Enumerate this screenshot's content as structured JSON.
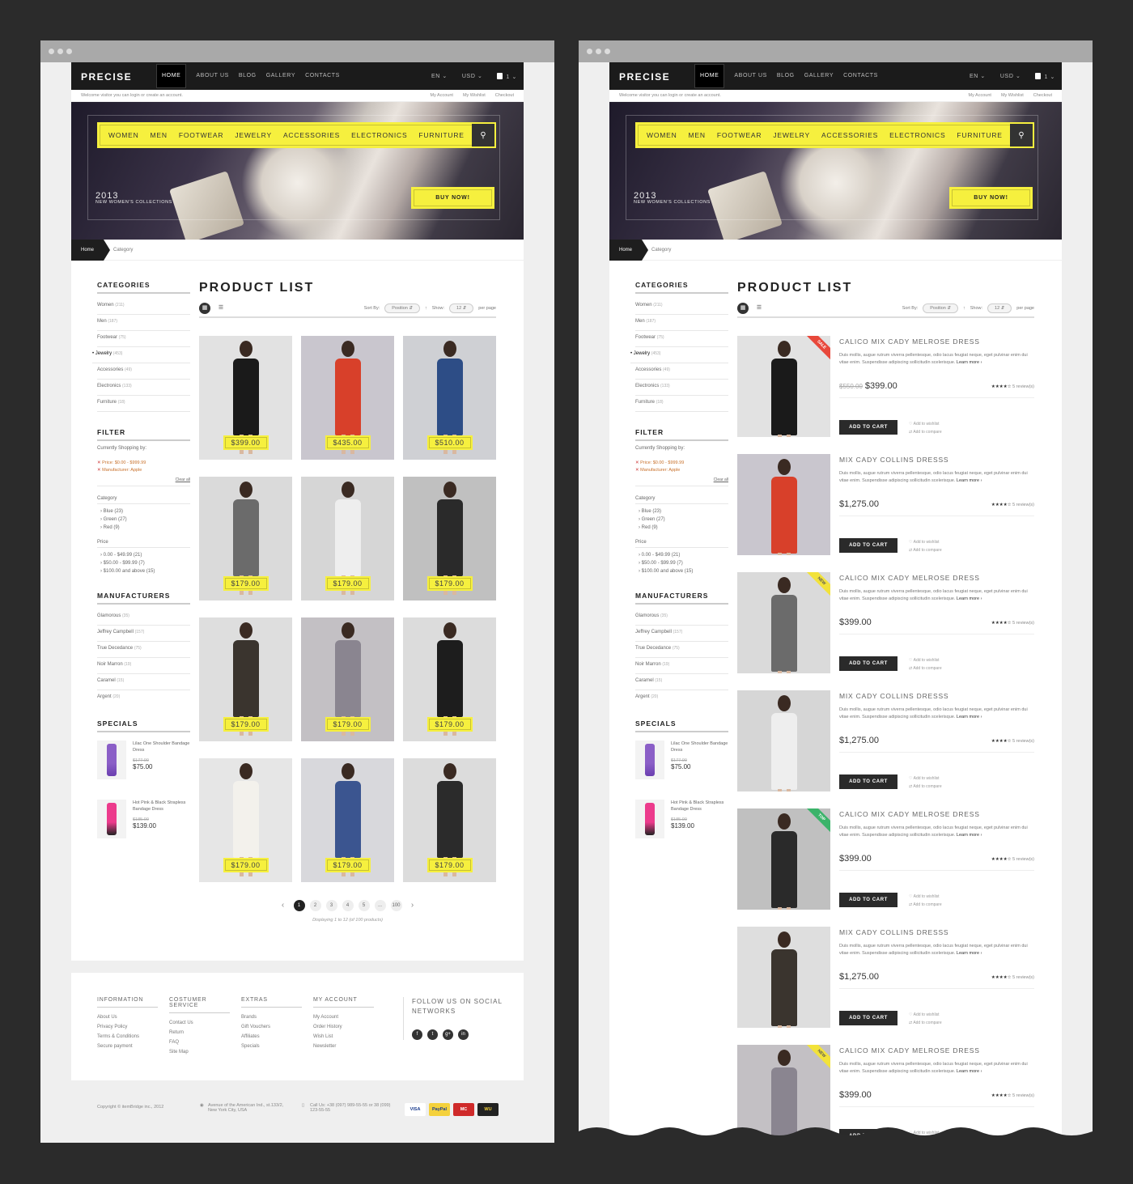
{
  "header": {
    "logo": "PRECISE",
    "nav": [
      "HOME",
      "ABOUT US",
      "BLOG",
      "GALLERY",
      "CONTACTS"
    ],
    "lang": "EN ⌄",
    "currency": "USD ⌄",
    "cart_count": "1 ⌄",
    "welcome": "Welcome visitor you can login or create an account.",
    "links": [
      "My Account",
      "My Wishlist",
      "Checkout"
    ]
  },
  "hero": {
    "categories": [
      "WOMEN",
      "MEN",
      "FOOTWEAR",
      "JEWELRY",
      "ACCESSORIES",
      "ELECTRONICS",
      "FURNITURE"
    ],
    "year": "2013",
    "subtitle": "NEW WOMEN'S COLLECTIONS",
    "button": "BUY NOW!"
  },
  "breadcrumb": {
    "home": "Home",
    "current": "Category"
  },
  "sidebar": {
    "categories_title": "CATEGORIES",
    "categories": [
      {
        "name": "Women",
        "count": "(211)"
      },
      {
        "name": "Men",
        "count": "(187)"
      },
      {
        "name": "Footwear",
        "count": "(75)"
      },
      {
        "name": "Jewelry",
        "count": "(453)"
      },
      {
        "name": "Accessories",
        "count": "(49)"
      },
      {
        "name": "Electronics",
        "count": "(133)"
      },
      {
        "name": "Furniture",
        "count": "(18)"
      }
    ],
    "filter_title": "FILTER",
    "currently": "Currently Shopping by:",
    "f_price": "Price: $0.00 - $999.99",
    "f_manu": "Manufacturer: Apple",
    "clear": "Clear all",
    "category_label": "Category",
    "cat_opts": [
      "Blue (23)",
      "Green (27)",
      "Red (9)"
    ],
    "price_label": "Price",
    "price_opts": [
      "0.00 - $49.99 (21)",
      "$50.00 - $99.99 (7)",
      "$100.00 and above (15)"
    ],
    "manufacturers_title": "MANUFACTURERS",
    "manufacturers": [
      {
        "name": "Glamorous",
        "count": "(35)"
      },
      {
        "name": "Jeffrey Campbell",
        "count": "(157)"
      },
      {
        "name": "True Decedance",
        "count": "(75)"
      },
      {
        "name": "Noir Marron",
        "count": "(19)"
      },
      {
        "name": "Caramel",
        "count": "(15)"
      },
      {
        "name": "Argent",
        "count": "(20)"
      }
    ],
    "specials_title": "SPECIALS",
    "specials": [
      {
        "name": "Lilac One Shoulder Bandage Dress",
        "old": "$177.00",
        "price": "$75.00"
      },
      {
        "name": "Hot Pink & Black Strapless Bandage Dress",
        "old": "$185.00",
        "price": "$139.00"
      }
    ]
  },
  "main": {
    "title": "PRODUCT LIST",
    "sort_by": "Sort By:",
    "sort_value": "Position",
    "show": "Show:",
    "show_value": "12",
    "per_page": "per page",
    "grid_prices": [
      "$399.00",
      "$435.00",
      "$510.00",
      "$179.00",
      "$179.00",
      "$179.00",
      "$179.00",
      "$179.00",
      "$179.00",
      "$179.00",
      "$179.00",
      "$179.00"
    ],
    "pages": [
      "1",
      "2",
      "3",
      "4",
      "5",
      "...",
      "100"
    ],
    "displaying": "Displaying 1 to 12 (of 100 products)"
  },
  "list": {
    "desc": "Duis mollis, augue rutrum viverra pellentesque, odio lacus feugiat neque, eget pulvinar enim dui vitae enim. Suspendisse adipiscing sollicitudin scelerisque.",
    "learn_more": "Learn more ›",
    "add_to_cart": "ADD TO CART",
    "wishlist": "Add to wishlist",
    "compare": "Add to compare",
    "stars": "★★★★☆",
    "reviews": "5 review(s)",
    "items": [
      {
        "name": "CALICO MIX CADY MELROSE DRESS",
        "old": "$550.00",
        "price": "$399.00",
        "ribbon": "SALE"
      },
      {
        "name": "MIX CADY COLLINS DRESSS",
        "old": "",
        "price": "$1,275.00",
        "ribbon": ""
      },
      {
        "name": "CALICO MIX CADY MELROSE DRESS",
        "old": "",
        "price": "$399.00",
        "ribbon": "NEW"
      },
      {
        "name": "MIX CADY COLLINS DRESSS",
        "old": "",
        "price": "$1,275.00",
        "ribbon": ""
      },
      {
        "name": "CALICO MIX CADY MELROSE DRESS",
        "old": "",
        "price": "$399.00",
        "ribbon": "TOP"
      },
      {
        "name": "MIX CADY COLLINS DRESSS",
        "old": "",
        "price": "$1,275.00",
        "ribbon": ""
      },
      {
        "name": "CALICO MIX CADY MELROSE DRESS",
        "old": "",
        "price": "$399.00",
        "ribbon": "NEW"
      }
    ]
  },
  "footer": {
    "cols": [
      {
        "title": "INFORMATION",
        "links": [
          "About Us",
          "Privacy Policy",
          "Terms & Conditions",
          "Secure payment"
        ]
      },
      {
        "title": "COSTUMER SERVICE",
        "links": [
          "Contact Us",
          "Return",
          "FAQ",
          "Site Map"
        ]
      },
      {
        "title": "EXTRAS",
        "links": [
          "Brands",
          "Gift Vouchers",
          "Affiliates",
          "Specials"
        ]
      },
      {
        "title": "MY ACCOUNT",
        "links": [
          "My Account",
          "Order History",
          "Wish List",
          "Newsletter"
        ]
      }
    ],
    "social_title": "FOLLOW US ON SOCIAL NETWORKS",
    "social": [
      "f",
      "t",
      "g+",
      "in"
    ],
    "copyright": "Copyright © itemBridge inc., 2012",
    "address": "Avenue of the American Ind., st.133/2, New York City, USA",
    "call": "Call Us: +38 (097) 989-55-55 or 38 (099) 123-55-55",
    "payments": [
      "VISA",
      "PayPal",
      "MC",
      "WU"
    ]
  }
}
